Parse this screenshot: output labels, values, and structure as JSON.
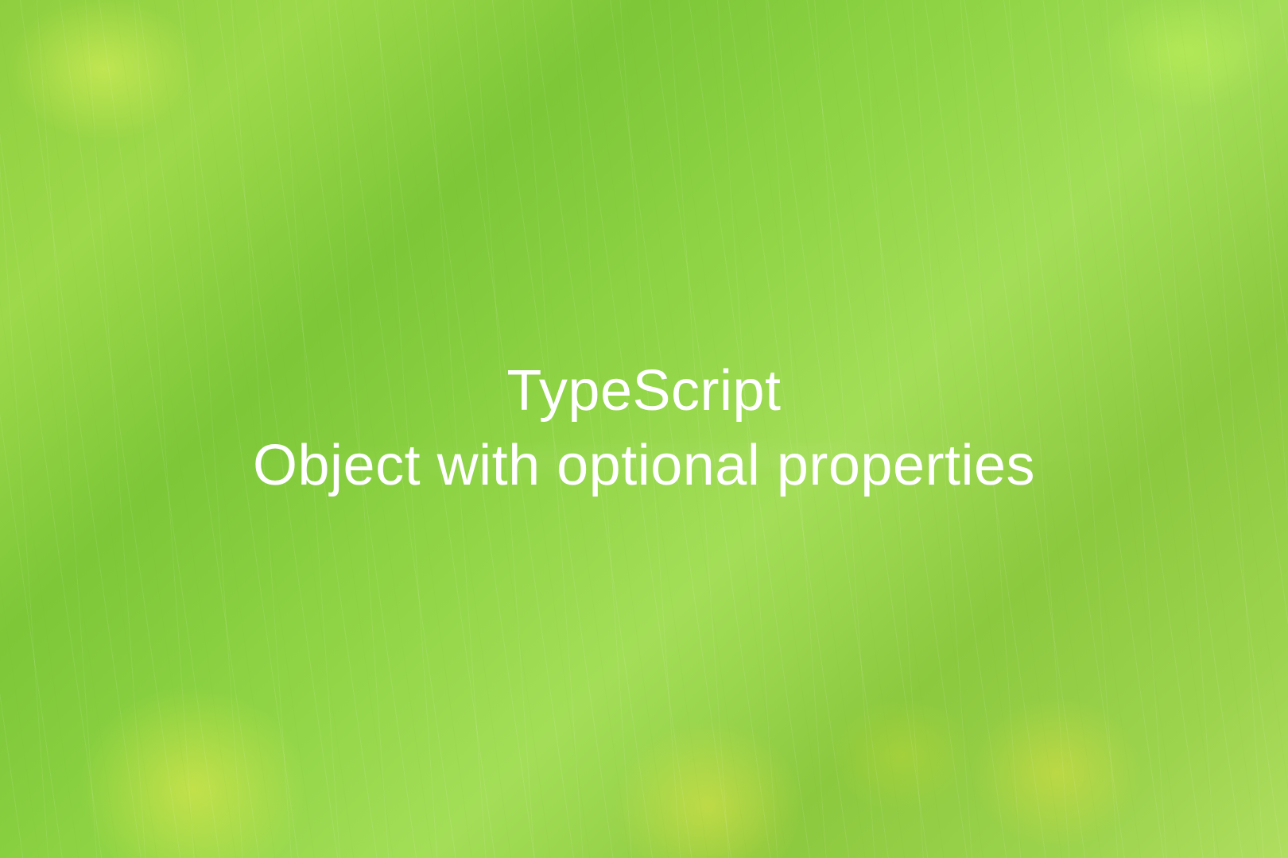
{
  "title": {
    "line1": "TypeScript",
    "line2": "Object with optional properties"
  }
}
